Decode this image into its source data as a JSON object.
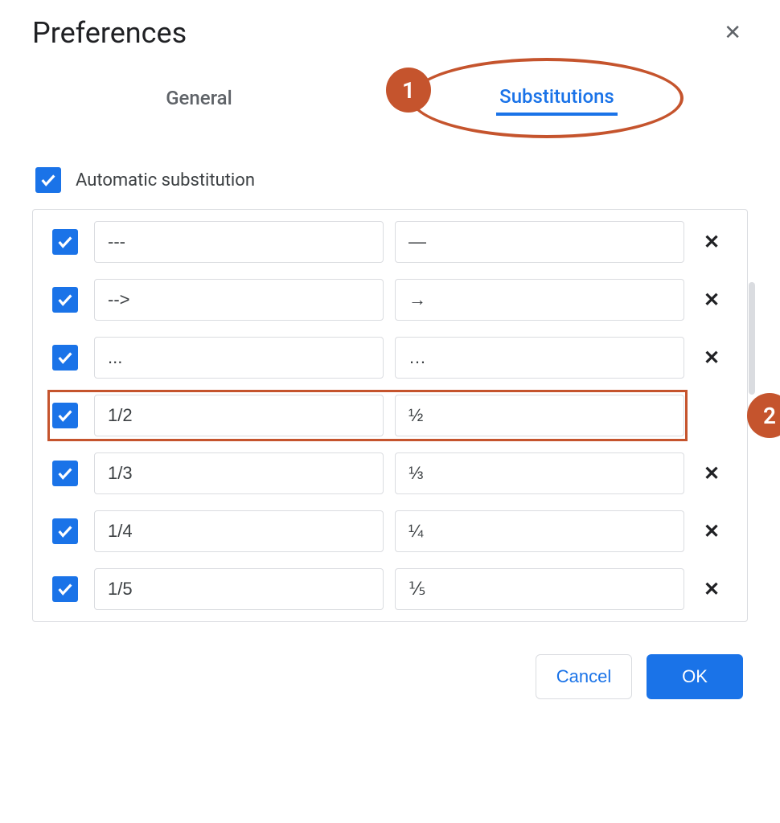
{
  "dialog": {
    "title": "Preferences"
  },
  "tabs": {
    "general": "General",
    "substitutions": "Substitutions",
    "active": "substitutions"
  },
  "auto_sub": {
    "label": "Automatic substitution",
    "checked": true
  },
  "rows": [
    {
      "checked": true,
      "from": "---",
      "to": "—",
      "highlighted": false
    },
    {
      "checked": true,
      "from": "-->",
      "to": "→",
      "highlighted": false
    },
    {
      "checked": true,
      "from": "...",
      "to": "…",
      "highlighted": false
    },
    {
      "checked": true,
      "from": "1/2",
      "to": "½",
      "highlighted": true
    },
    {
      "checked": true,
      "from": "1/3",
      "to": "⅓",
      "highlighted": false
    },
    {
      "checked": true,
      "from": "1/4",
      "to": "¼",
      "highlighted": false
    },
    {
      "checked": true,
      "from": "1/5",
      "to": "⅕",
      "highlighted": false
    }
  ],
  "buttons": {
    "cancel": "Cancel",
    "ok": "OK"
  },
  "annotations": {
    "step1": "1",
    "step2": "2"
  },
  "colors": {
    "accent": "#1a73e8",
    "annotation": "#c5542d"
  }
}
